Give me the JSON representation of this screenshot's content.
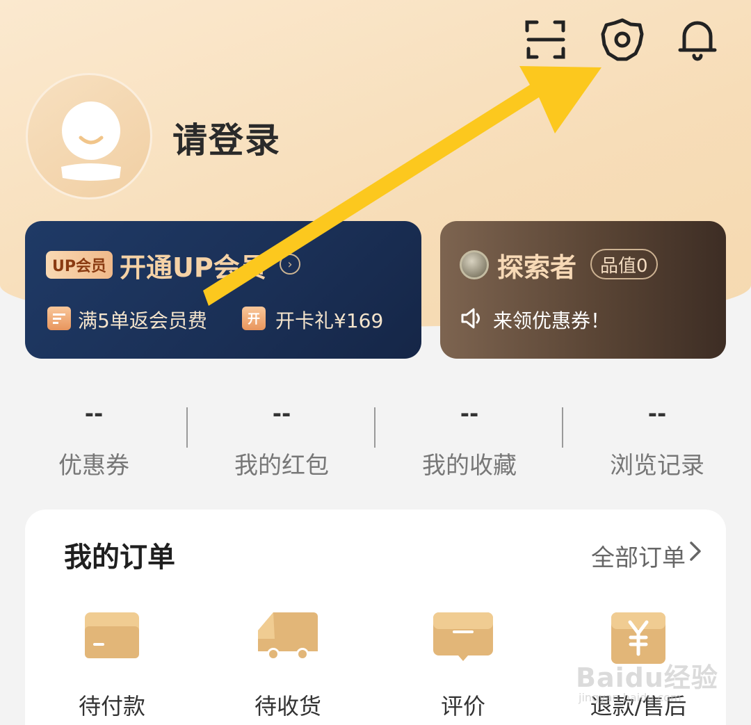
{
  "header": {
    "icons": [
      "scan-icon",
      "gear-icon",
      "bell-icon"
    ],
    "login_text": "请登录"
  },
  "vip_card": {
    "badge": "UP会员",
    "title": "开通UP会员",
    "perk1": "满5单返会员费",
    "perk1_icon_char": "",
    "perk2": "开卡礼¥169",
    "perk2_icon_char": "开"
  },
  "explorer_card": {
    "title": "探索者",
    "level": "品值0",
    "coupon_text": "来领优惠券！"
  },
  "stats": [
    {
      "value": "--",
      "label": "优惠券"
    },
    {
      "value": "--",
      "label": "我的红包"
    },
    {
      "value": "--",
      "label": "我的收藏"
    },
    {
      "value": "--",
      "label": "浏览记录"
    }
  ],
  "orders": {
    "title": "我的订单",
    "all_label": "全部订单",
    "items": [
      {
        "label": "待付款",
        "icon": "wallet-card-icon"
      },
      {
        "label": "待收货",
        "icon": "delivery-truck-icon"
      },
      {
        "label": "评价",
        "icon": "comment-icon"
      },
      {
        "label": "退款/售后",
        "icon": "yuan-refund-icon"
      }
    ]
  },
  "watermark": {
    "text": "Baidu经验",
    "sub": "jingyan.baidu.com"
  },
  "colors": {
    "header_bg": "#f7ddb8",
    "vip_card_bg": "#1f3a66",
    "explorer_card_bg": "#5a4535",
    "gold_text": "#f5d2a6",
    "order_icon": "#e2b678",
    "arrow_overlay": "#fcc81e"
  }
}
